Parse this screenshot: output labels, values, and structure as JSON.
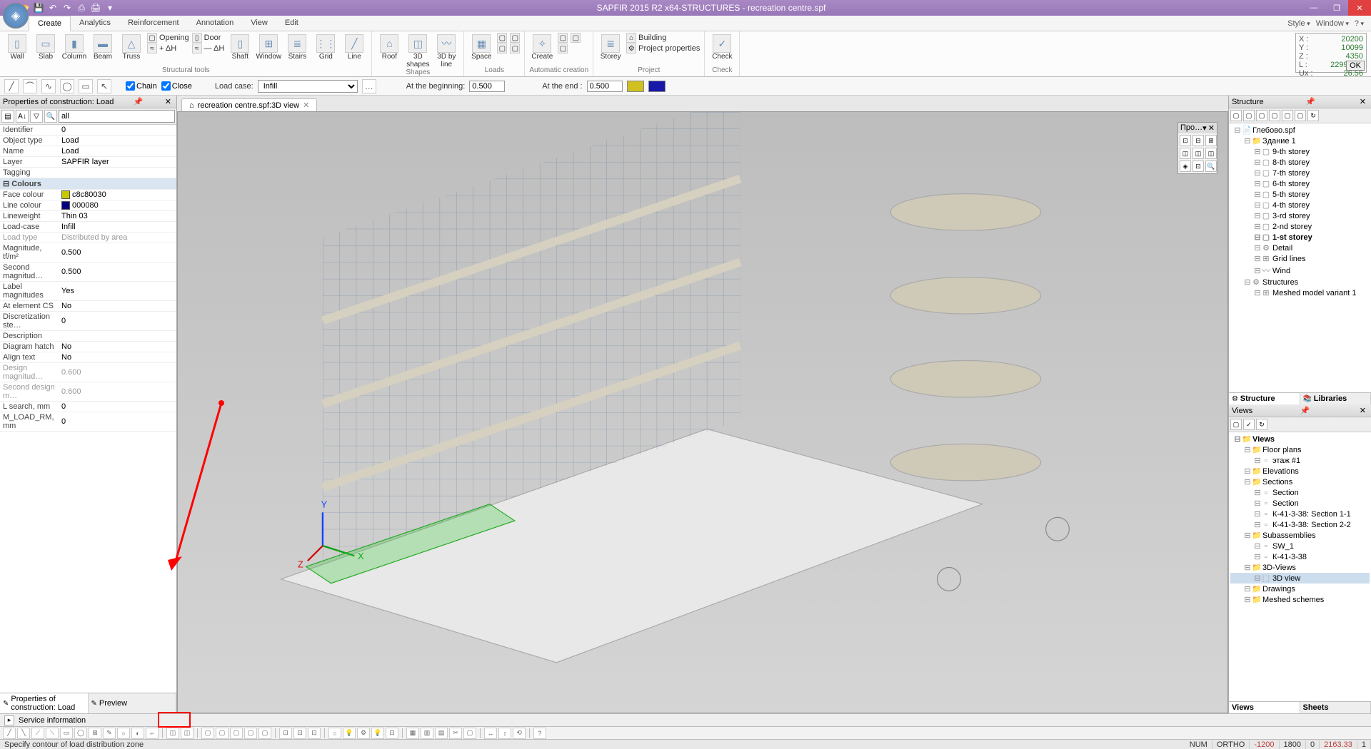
{
  "title": "SAPFIR 2015 R2 x64-STRUCTURES - recreation centre.spf",
  "tabs": {
    "create": "Create",
    "analytics": "Analytics",
    "reinforcement": "Reinforcement",
    "annotation": "Annotation",
    "view": "View",
    "edit": "Edit"
  },
  "right_menu": {
    "style": "Style",
    "window": "Window",
    "help": "?"
  },
  "ribbon": {
    "tools": {
      "wall": "Wall",
      "slab": "Slab",
      "column": "Column",
      "beam": "Beam",
      "truss": "Truss",
      "opening": "Opening",
      "door": "Door",
      "ah_plus": "+ ΔH",
      "ah_minus": "— ΔH",
      "shaft": "Shaft",
      "window": "Window",
      "stairs": "Stairs",
      "grid": "Grid",
      "line": "Line",
      "label": "Structural tools"
    },
    "shapes": {
      "roof": "Roof",
      "shapes_btn": "3D\nshapes",
      "line3d": "3D by\nline",
      "label": "Shapes"
    },
    "loads": {
      "space": "Space",
      "label": "Loads"
    },
    "auto": {
      "create_btn": "Create",
      "label": "Automatic creation"
    },
    "project": {
      "storey": "Storey",
      "building": "Building",
      "props": "Project properties",
      "label": "Project"
    },
    "check": {
      "check_btn": "Check",
      "label": "Check"
    }
  },
  "coords": {
    "x_k": "X :",
    "x_v": "20200",
    "y_k": "Y :",
    "y_v": "10099",
    "z_k": "Z :",
    "z_v": "4350",
    "l_k": "L :",
    "l_v": "22998.96",
    "ux_k": "Ux :",
    "ux_v": "26.56",
    "ok": "OK"
  },
  "optbar": {
    "chain": "Chain",
    "close": "Close",
    "loadcase_lbl": "Load case:",
    "loadcase_val": "Infill",
    "begin_lbl": "At the beginning:",
    "begin_val": "0.500",
    "end_lbl": "At the end :",
    "end_val": "0.500",
    "color1": "#d0c020",
    "color2": "#1818a8"
  },
  "props_panel": {
    "title": "Properties of construction: Load",
    "filter_val": "all",
    "rows": [
      {
        "k": "Identifier",
        "v": "0"
      },
      {
        "k": "Object type",
        "v": "Load"
      },
      {
        "k": "Name",
        "v": "Load"
      },
      {
        "k": "Layer",
        "v": "SAPFIR layer"
      },
      {
        "k": "Tagging",
        "v": ""
      }
    ],
    "section_colours": "Colours",
    "face_colour_lbl": "Face colour",
    "face_colour_val": "c8c80030",
    "face_colour_sw": "#c8c800",
    "line_colour_lbl": "Line colour",
    "line_colour_val": "000080",
    "line_colour_sw": "#000080",
    "rows2": [
      {
        "k": "Lineweight",
        "v": "Thin 03"
      },
      {
        "k": "Load-case",
        "v": "Infill"
      },
      {
        "k": "Load type",
        "v": "Distributed by area",
        "dim": true
      },
      {
        "k": "Magnitude, tf/m²",
        "v": "0.500"
      },
      {
        "k": "Second magnitud…",
        "v": "0.500"
      },
      {
        "k": "Label magnitudes",
        "v": "Yes"
      },
      {
        "k": "At element CS",
        "v": "No"
      },
      {
        "k": "Discretization ste…",
        "v": "0"
      },
      {
        "k": "Description",
        "v": ""
      },
      {
        "k": "Diagram hatch",
        "v": "No"
      },
      {
        "k": "Align text",
        "v": "No"
      },
      {
        "k": "Design magnitud…",
        "v": "0.600",
        "dim": true
      },
      {
        "k": "Second design m…",
        "v": "0.600",
        "dim": true
      },
      {
        "k": "L search, mm",
        "v": "0"
      },
      {
        "k": "M_LOAD_RM, mm",
        "v": "0"
      }
    ],
    "tab1": "Properties of construction: Load",
    "tab2": "Preview"
  },
  "doc_tab": "recreation centre.spf:3D view",
  "view_fly_title": "Про…",
  "structure_panel": {
    "title": "Structure",
    "nodes": [
      {
        "d": 0,
        "t": "Глебово.spf",
        "ico": "📄"
      },
      {
        "d": 1,
        "t": "Здание 1",
        "ico": "📁"
      },
      {
        "d": 2,
        "t": "9-th storey",
        "ico": "▢"
      },
      {
        "d": 2,
        "t": "8-th storey",
        "ico": "▢"
      },
      {
        "d": 2,
        "t": "7-th storey",
        "ico": "▢"
      },
      {
        "d": 2,
        "t": "6-th storey",
        "ico": "▢"
      },
      {
        "d": 2,
        "t": "5-th storey",
        "ico": "▢"
      },
      {
        "d": 2,
        "t": "4-th storey",
        "ico": "▢"
      },
      {
        "d": 2,
        "t": "3-rd storey",
        "ico": "▢"
      },
      {
        "d": 2,
        "t": "2-nd storey",
        "ico": "▢"
      },
      {
        "d": 2,
        "t": "1-st storey",
        "ico": "▢",
        "bold": true
      },
      {
        "d": 2,
        "t": "Detail",
        "ico": "⚙"
      },
      {
        "d": 2,
        "t": "Grid lines",
        "ico": "⊞"
      },
      {
        "d": 2,
        "t": "Wind",
        "ico": "〰"
      },
      {
        "d": 1,
        "t": "Structures",
        "ico": "⚙"
      },
      {
        "d": 2,
        "t": "Meshed model variant 1",
        "ico": "⊞"
      }
    ],
    "tab1": "Structure",
    "tab2": "Libraries"
  },
  "views_panel": {
    "title": "Views",
    "nodes": [
      {
        "d": 0,
        "t": "Views",
        "ico": "📁",
        "bold": true
      },
      {
        "d": 1,
        "t": "Floor plans",
        "ico": "📁"
      },
      {
        "d": 2,
        "t": "этаж #1",
        "ico": "▫"
      },
      {
        "d": 1,
        "t": "Elevations",
        "ico": "📁"
      },
      {
        "d": 1,
        "t": "Sections",
        "ico": "📁"
      },
      {
        "d": 2,
        "t": "Section",
        "ico": "▫"
      },
      {
        "d": 2,
        "t": "Section",
        "ico": "▫"
      },
      {
        "d": 2,
        "t": "К-41-3-38: Section 1-1",
        "ico": "▫"
      },
      {
        "d": 2,
        "t": "К-41-3-38: Section 2-2",
        "ico": "▫"
      },
      {
        "d": 1,
        "t": "Subassemblies",
        "ico": "📁"
      },
      {
        "d": 2,
        "t": "SW_1",
        "ico": "▫"
      },
      {
        "d": 2,
        "t": "К-41-3-38",
        "ico": "▫"
      },
      {
        "d": 1,
        "t": "3D-Views",
        "ico": "📁"
      },
      {
        "d": 2,
        "t": "3D view",
        "ico": "⬚",
        "sel": true
      },
      {
        "d": 1,
        "t": "Drawings",
        "ico": "📁"
      },
      {
        "d": 1,
        "t": "Meshed schemes",
        "ico": "📁"
      }
    ],
    "tab1": "Views",
    "tab2": "Sheets"
  },
  "service_info": "Service information",
  "status": {
    "msg": "Specify contour of load distribution zone",
    "num": "NUM",
    "ortho": "ORTHO",
    "v1": "-1200",
    "v2": "1800",
    "v3": "0",
    "v4": "2163.33",
    "v5": "1"
  }
}
